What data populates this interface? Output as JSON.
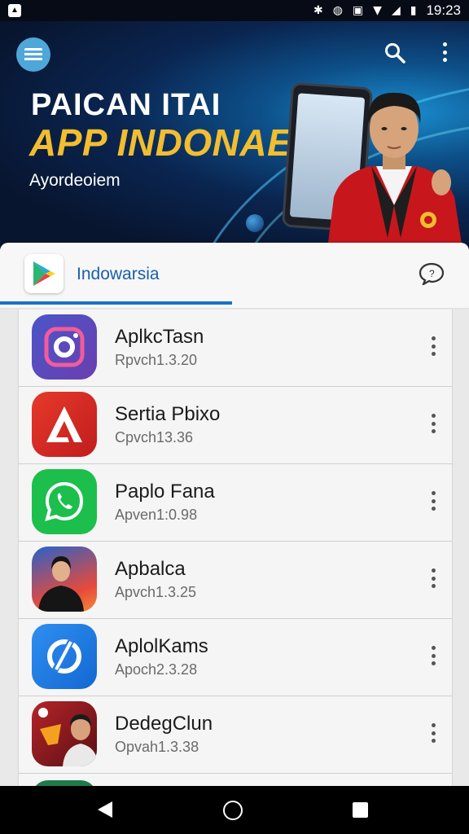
{
  "status_bar": {
    "time": "19:23",
    "icons": [
      "notification-icon",
      "bluetooth-icon",
      "vibrate-icon",
      "nfc-icon",
      "wifi-icon",
      "signal-icon",
      "battery-icon"
    ]
  },
  "hero": {
    "title_line1": "PAICAN ITAI",
    "title_line2": "APP INDONAESA",
    "subtitle": "Ayordeoiem",
    "title_color": "#f2bd2f"
  },
  "tab": {
    "label": "Indowarsia",
    "accent": "#1a73c8"
  },
  "apps": [
    {
      "name": "AplkcTasn",
      "version": "Rpvch1.3.20",
      "icon": "camera-app-icon"
    },
    {
      "name": "Sertia Pbixo",
      "version": "Cpvch13.36",
      "icon": "red-a-app-icon"
    },
    {
      "name": "Paplo Fana",
      "version": "Apven1:0.98",
      "icon": "whatsapp-icon"
    },
    {
      "name": "Apbalca",
      "version": "Apvch1.3.25",
      "icon": "portrait-app-icon"
    },
    {
      "name": "AplolKams",
      "version": "Apoch2.3.28",
      "icon": "blue-circle-app-icon"
    },
    {
      "name": "DedegClun",
      "version": "Opvah1.3.38",
      "icon": "duo-portrait-app-icon"
    }
  ]
}
